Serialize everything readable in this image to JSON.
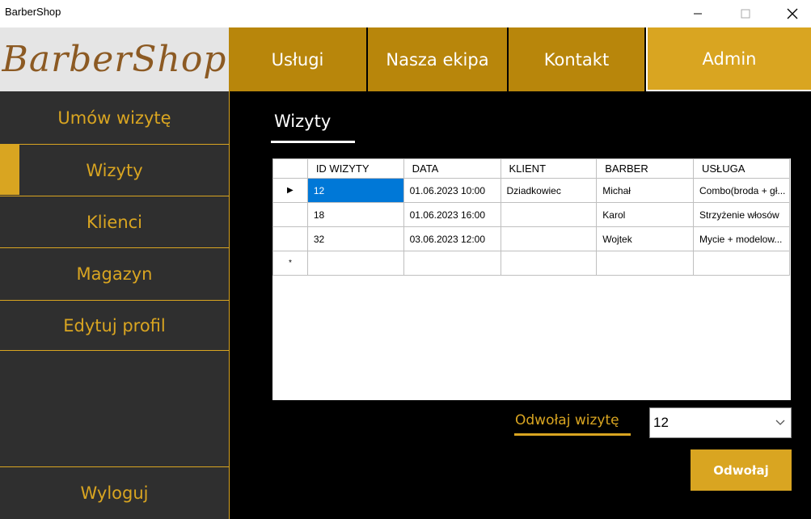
{
  "window": {
    "title": "BarberShop"
  },
  "logo": {
    "text": "BarberShop"
  },
  "topnav": {
    "tabs": [
      {
        "label": "Usługi"
      },
      {
        "label": "Nasza ekipa"
      },
      {
        "label": "Kontakt"
      },
      {
        "label": "Admin"
      }
    ]
  },
  "sidebar": {
    "items": [
      {
        "label": "Umów wizytę"
      },
      {
        "label": "Wizyty",
        "active": true
      },
      {
        "label": "Klienci"
      },
      {
        "label": "Magazyn"
      },
      {
        "label": "Edytuj profil"
      }
    ],
    "logout_label": "Wyloguj"
  },
  "main": {
    "title": "Wizyty",
    "grid": {
      "columns": [
        "ID WIZYTY",
        "DATA",
        "KLIENT",
        "BARBER",
        "USŁUGA"
      ],
      "rows": [
        {
          "marker": "▶",
          "cells": [
            "12",
            "01.06.2023 10:00",
            "Dziadkowiec",
            "Michał",
            "Combo(broda + gł..."
          ]
        },
        {
          "marker": "",
          "cells": [
            "18",
            "01.06.2023 16:00",
            "",
            "Karol",
            "Strzyżenie włosów"
          ]
        },
        {
          "marker": "",
          "cells": [
            "32",
            "03.06.2023 12:00",
            "",
            "Wojtek",
            "Mycie + modelow..."
          ]
        },
        {
          "marker": "*",
          "cells": [
            "",
            "",
            "",
            "",
            ""
          ]
        }
      ]
    },
    "cancel_label": "Odwołaj wizytę",
    "combo_value": "12",
    "cancel_button": "Odwołaj"
  },
  "colors": {
    "accent": "#d9a521",
    "tab_dark": "#b8860b",
    "sidebar_bg": "#2f2f2f",
    "logo_text": "#8c5a23",
    "selection": "#0078d7"
  }
}
